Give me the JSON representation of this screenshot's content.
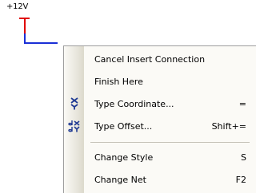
{
  "canvas": {
    "net_label": "+12V",
    "wire_colors": {
      "pin": "#e00000",
      "connection": "#1a2fd6"
    }
  },
  "menu": {
    "items": [
      {
        "label": "Cancel Insert Connection",
        "shortcut": "",
        "icon": ""
      },
      {
        "label": "Finish Here",
        "shortcut": "",
        "icon": ""
      },
      {
        "label": "Type Coordinate...",
        "shortcut": "=",
        "icon": "xy-coordinate-icon"
      },
      {
        "label": "Type Offset...",
        "shortcut": "Shift+=",
        "icon": "dx-dy-offset-icon"
      },
      {
        "label": "Change Style",
        "shortcut": "S",
        "icon": ""
      },
      {
        "label": "Change Net",
        "shortcut": "F2",
        "icon": ""
      }
    ]
  },
  "colors": {
    "menu_background": "#fbfaf6",
    "icon_blue": "#1f3a93"
  }
}
